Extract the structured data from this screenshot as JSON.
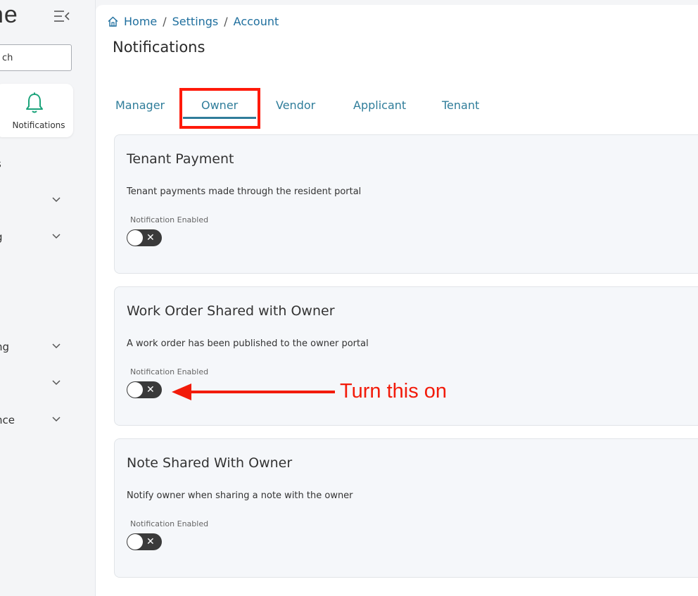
{
  "sidebar": {
    "logo_text": "ne",
    "search_value": "ch",
    "active_item": {
      "label": "Notifications"
    },
    "nav_items": [
      {
        "label": "s",
        "has_chevron": false
      },
      {
        "label": "",
        "has_chevron": true
      },
      {
        "label": "g",
        "has_chevron": true
      },
      {
        "label": "ng",
        "has_chevron": true
      },
      {
        "label": "",
        "has_chevron": true
      },
      {
        "label": "nce",
        "has_chevron": true
      }
    ]
  },
  "breadcrumb": [
    "Home",
    "Settings",
    "Account"
  ],
  "page_title": "Notifications",
  "tabs": [
    "Manager",
    "Owner",
    "Vendor",
    "Applicant",
    "Tenant"
  ],
  "active_tab": "Owner",
  "cards": [
    {
      "title": "Tenant Payment",
      "description": "Tenant payments made through the resident portal",
      "field_label": "Notification Enabled",
      "enabled": false
    },
    {
      "title": "Work Order Shared with Owner",
      "description": "A work order has been published to the owner portal",
      "field_label": "Notification Enabled",
      "enabled": false
    },
    {
      "title": "Note Shared With Owner",
      "description": "Notify owner when sharing a note with the owner",
      "field_label": "Notification Enabled",
      "enabled": false
    }
  ],
  "annotation": {
    "text": "Turn this on"
  },
  "colors": {
    "accent": "#2f7d9a",
    "link": "#1f6f9e",
    "highlight": "#ff1a0a",
    "bell": "#1aa37a",
    "toggle_off": "#3a3a3a"
  }
}
